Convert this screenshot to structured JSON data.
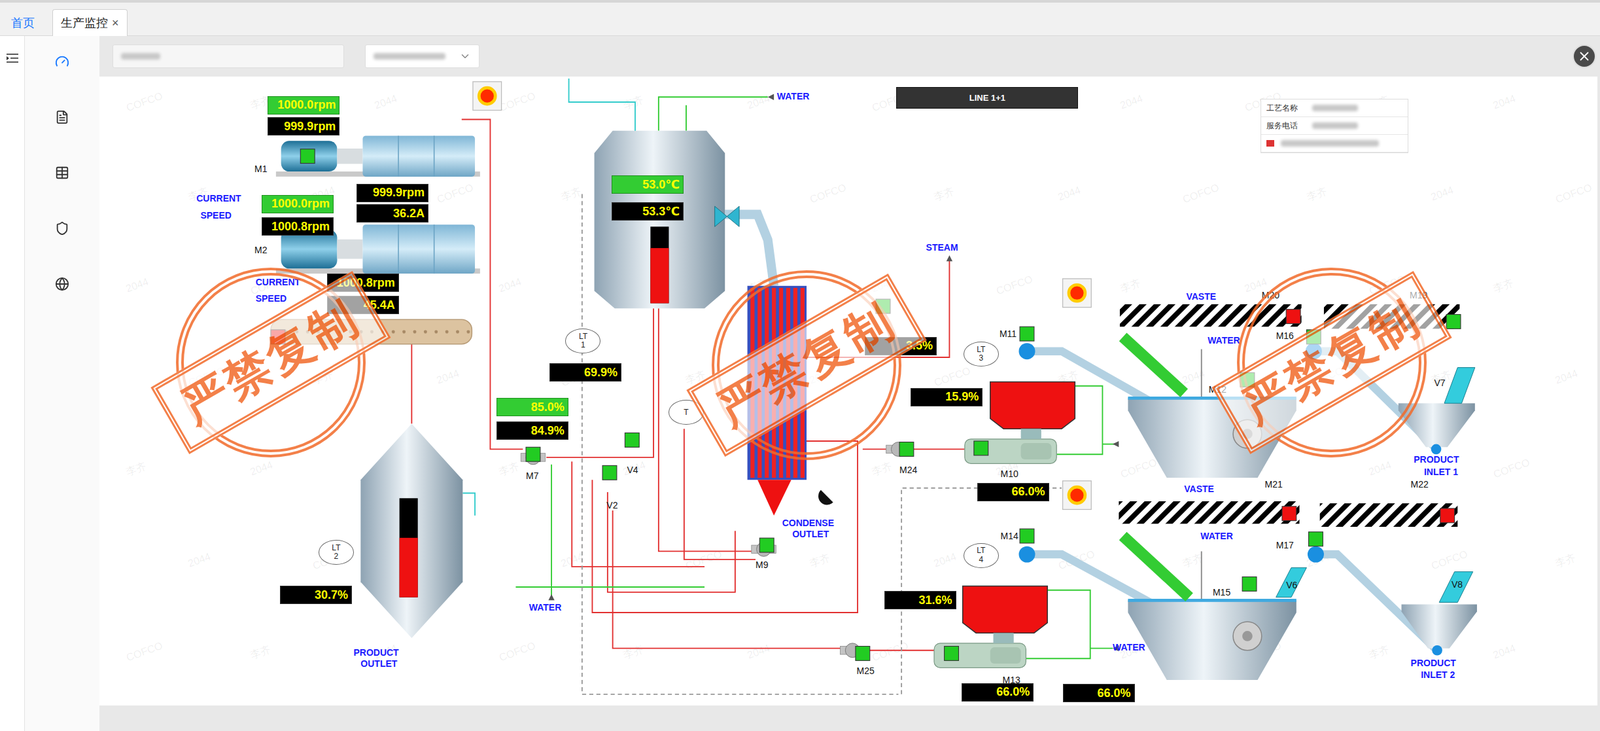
{
  "tabs": [
    {
      "label": "首页",
      "selected": false,
      "close": ""
    },
    {
      "label": "生产监控",
      "selected": true,
      "close": "×"
    }
  ],
  "sidebar": {
    "items": [
      {
        "selected": true
      },
      {
        "selected": false
      },
      {
        "selected": false
      },
      {
        "selected": false
      },
      {
        "selected": false
      }
    ]
  },
  "line_banner": "LINE 1+1",
  "info_box": {
    "rows": [
      "工艺名称",
      "服务电话"
    ]
  },
  "readings": [
    {
      "text": "1000.0rpm",
      "kind": "setpoint"
    },
    {
      "text": "999.9rpm",
      "kind": "actual"
    },
    {
      "text": "1000.0rpm",
      "kind": "setpoint"
    },
    {
      "text": "1000.8rpm",
      "kind": "actual"
    },
    {
      "text": "999.9rpm",
      "kind": "actual"
    },
    {
      "text": "36.2A",
      "kind": "actual"
    },
    {
      "text": "1000.8rpm",
      "kind": "actual"
    },
    {
      "text": "45.4A",
      "kind": "actual"
    },
    {
      "text": "53.0℃",
      "kind": "setpoint"
    },
    {
      "text": "53.3℃",
      "kind": "actual"
    },
    {
      "text": "69.9%",
      "kind": "actual"
    },
    {
      "text": "85.0%",
      "kind": "setpoint"
    },
    {
      "text": "84.9%",
      "kind": "actual"
    },
    {
      "text": "3.5%",
      "kind": "actual"
    },
    {
      "text": "15.9%",
      "kind": "actual"
    },
    {
      "text": "66.0%",
      "kind": "actual"
    },
    {
      "text": "31.6%",
      "kind": "actual"
    },
    {
      "text": "66.0%",
      "kind": "actual"
    },
    {
      "text": "66.0%",
      "kind": "actual"
    },
    {
      "text": "30.7%",
      "kind": "actual"
    }
  ],
  "labels": [
    "WATER",
    "STEAM",
    "CURRENT",
    "SPEED",
    "CURRENT",
    "SPEED",
    "WATER",
    "PRODUCT",
    "OUTLET",
    "CONDENSE",
    "OUTLET",
    "VASTE",
    "WATER",
    "VASTE",
    "WATER",
    "WATER",
    "PRODUCT",
    "INLET 1",
    "PRODUCT",
    "INLET 2"
  ],
  "tags": [
    "M1",
    "M2",
    "M7",
    "V4",
    "V2",
    "M9",
    "M24",
    "M10",
    "M25",
    "M13",
    "M11",
    "M14",
    "M12",
    "M15",
    "M16",
    "M17",
    "M20",
    "M19",
    "M21",
    "M22",
    "V6",
    "V7",
    "V8"
  ],
  "sensors": [
    {
      "top": "LT",
      "bottom": "1"
    },
    {
      "top": "LT",
      "bottom": "2"
    },
    {
      "top": "LT",
      "bottom": "3"
    },
    {
      "top": "LT",
      "bottom": "4"
    },
    {
      "top": "T",
      "bottom": ""
    }
  ],
  "status_lights": [
    {
      "color": "#22cc22"
    },
    {
      "color": "#22cc22"
    },
    {
      "color": "#22cc22"
    },
    {
      "color": "#22cc22"
    },
    {
      "color": "#22cc22"
    },
    {
      "color": "#22cc22"
    },
    {
      "color": "#22cc22"
    },
    {
      "color": "#22cc22"
    },
    {
      "color": "#22cc22"
    },
    {
      "color": "#22cc22"
    },
    {
      "color": "#22cc22"
    },
    {
      "color": "#22cc22"
    },
    {
      "color": "#22cc22"
    },
    {
      "color": "#22cc22"
    },
    {
      "color": "#22cc22"
    },
    {
      "color": "#22cc22"
    },
    {
      "color": "#22cc22"
    },
    {
      "color": "#ee1111"
    },
    {
      "color": "#ee1111"
    },
    {
      "color": "#ee1111"
    },
    {
      "color": "#ee1111"
    }
  ],
  "alarms": [
    {
      "on": true
    },
    {
      "on": true
    },
    {
      "on": true
    }
  ],
  "tank_levels": [
    {
      "level": 0.72
    },
    {
      "level": 0.6
    }
  ],
  "stamps": [
    "严禁复制",
    "严禁复制",
    "严禁复制"
  ],
  "watermarks": [
    "COFCO",
    "李齐",
    "2044"
  ]
}
